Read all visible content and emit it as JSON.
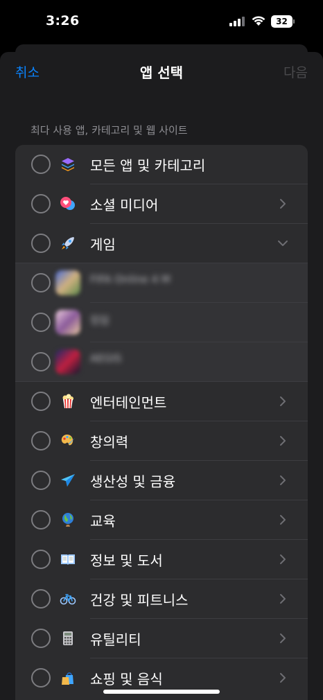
{
  "status": {
    "time": "3:26",
    "battery": "32"
  },
  "nav": {
    "cancel": "취소",
    "title": "앱 선택",
    "next": "다음"
  },
  "section_header": "최다 사용 앱, 카테고리 및 웹 사이트",
  "rows": [
    {
      "label": "모든 앱 및 카테고리",
      "icon": "stack-icon",
      "chevron": "none"
    },
    {
      "label": "소셜 미디어",
      "icon": "chat-bubbles-icon",
      "chevron": "right"
    },
    {
      "label": "게임",
      "icon": "rocket-icon",
      "chevron": "down"
    },
    {
      "label": "FIFA Online 4 M",
      "icon": "app-icon-blurred",
      "blurred": true
    },
    {
      "label": "킹덤",
      "icon": "app-icon-blurred",
      "blurred": true
    },
    {
      "label": "AEGIS",
      "icon": "app-icon-blurred",
      "blurred": true
    },
    {
      "label": "엔터테인먼트",
      "icon": "popcorn-icon",
      "chevron": "right"
    },
    {
      "label": "창의력",
      "icon": "palette-icon",
      "chevron": "right"
    },
    {
      "label": "생산성 및 금융",
      "icon": "paper-plane-icon",
      "chevron": "right"
    },
    {
      "label": "교육",
      "icon": "globe-icon",
      "chevron": "right"
    },
    {
      "label": "정보 및 도서",
      "icon": "book-icon",
      "chevron": "right"
    },
    {
      "label": "건강 및 피트니스",
      "icon": "bicycle-icon",
      "chevron": "right"
    },
    {
      "label": "유틸리티",
      "icon": "calculator-icon",
      "chevron": "right"
    },
    {
      "label": "쇼핑 및 음식",
      "icon": "shopping-bag-icon",
      "chevron": "right"
    }
  ],
  "colors": {
    "accent": "#0a84ff",
    "background": "#000000",
    "sheet": "#1c1c1e",
    "list": "#2c2c2e"
  }
}
